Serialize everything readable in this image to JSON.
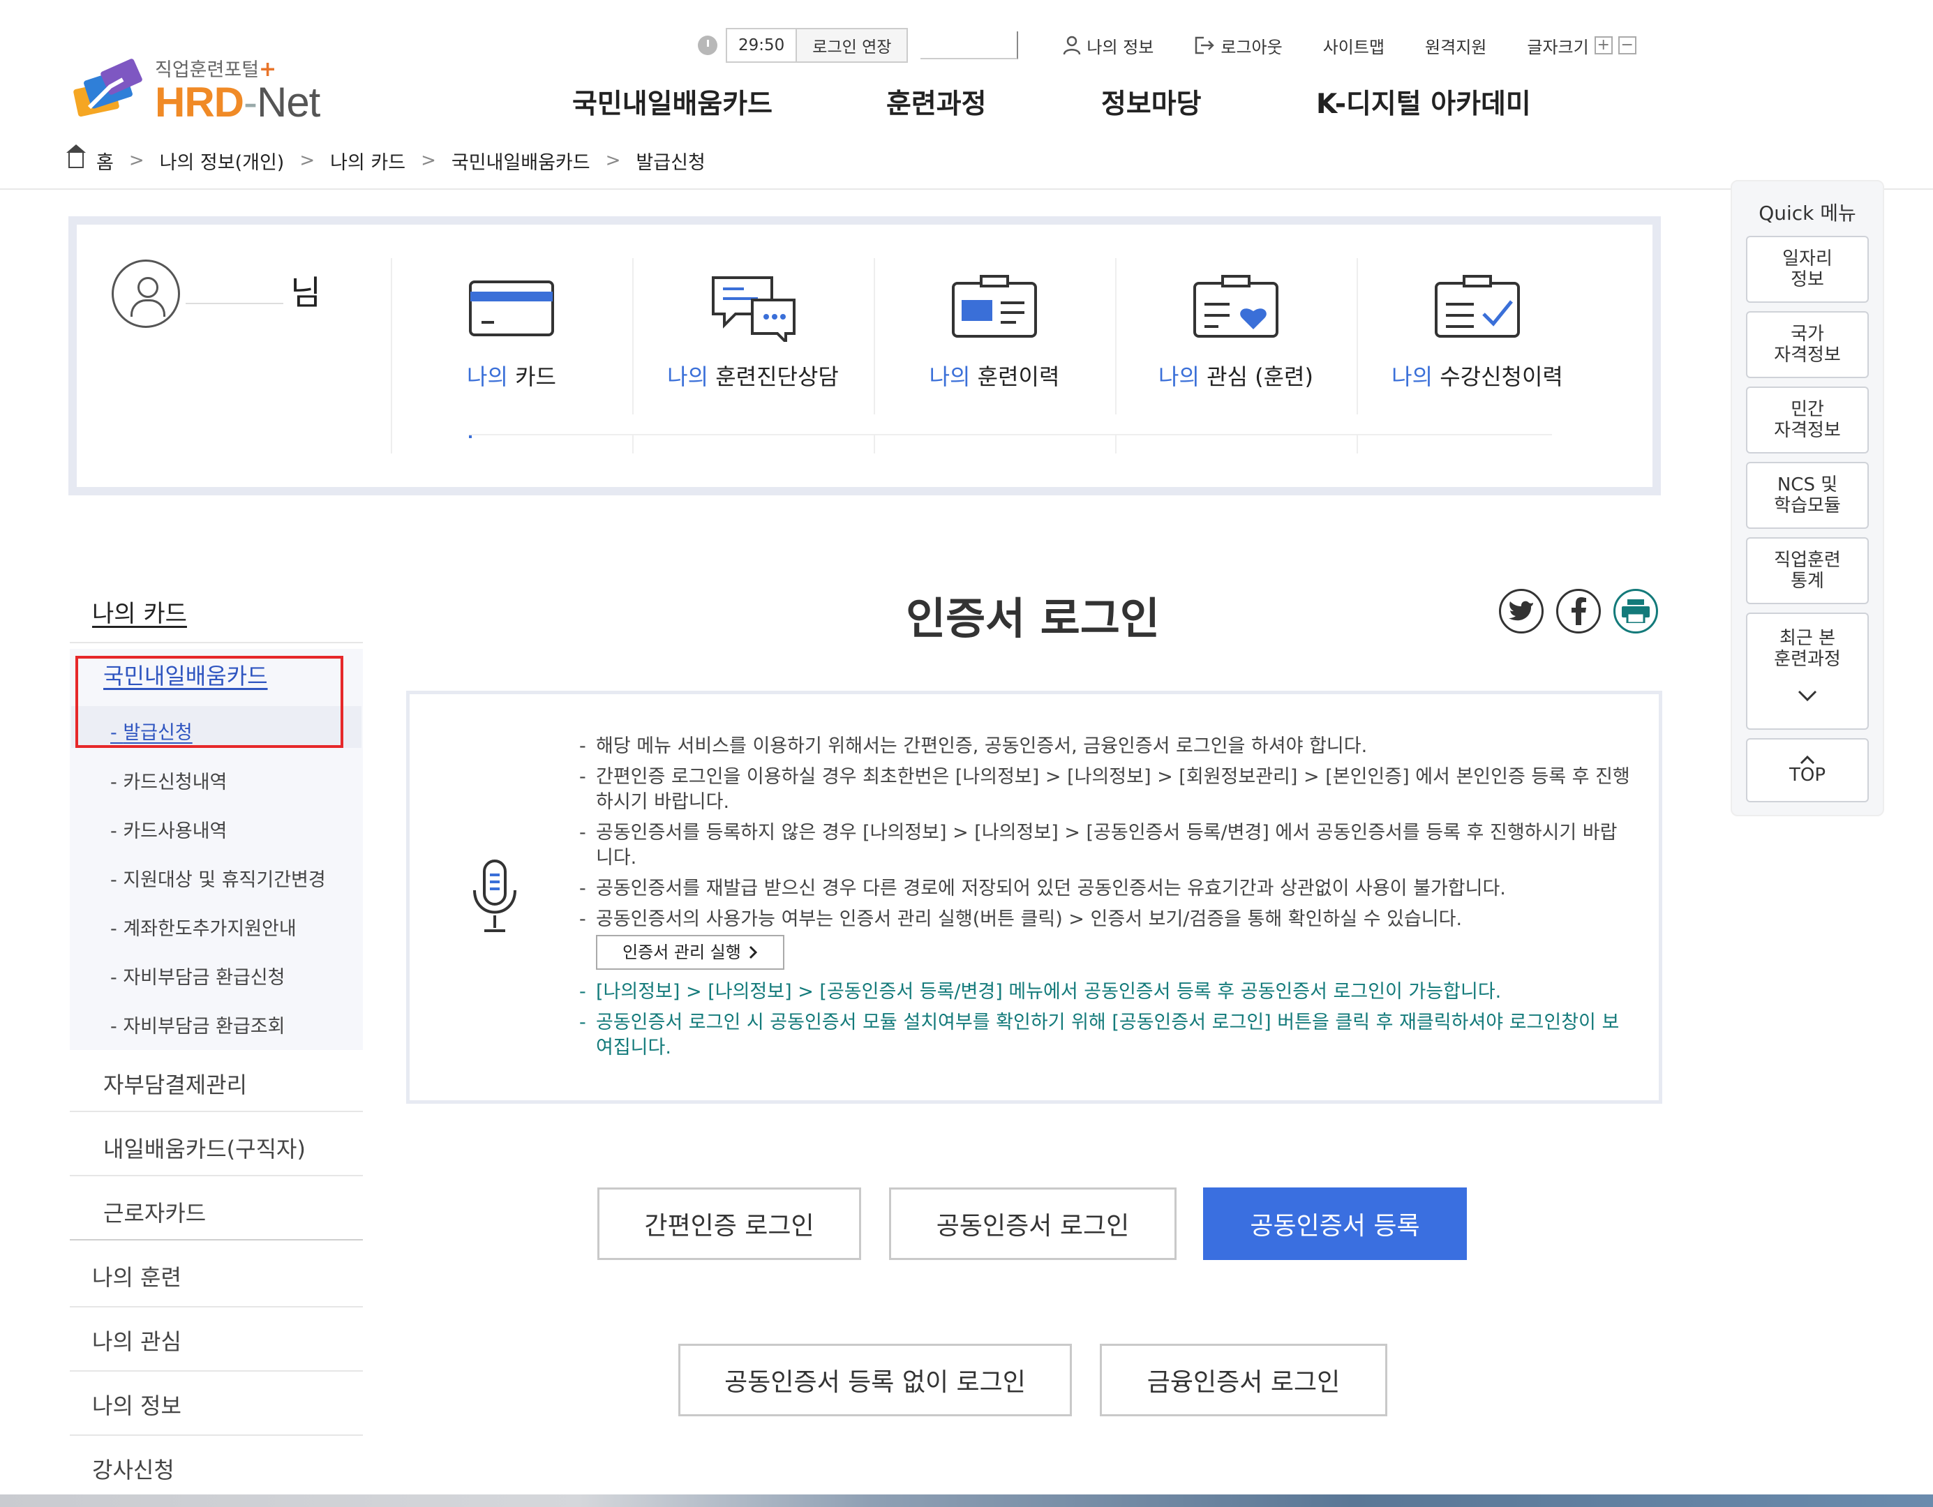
{
  "header": {
    "logo_sub": "직업훈련포털",
    "logo_main": "HRD",
    "logo_net": "Net",
    "timer": "29:50",
    "extend_label": "로그인 연장",
    "my_info": "나의 정보",
    "logout": "로그아웃",
    "sitemap": "사이트맵",
    "remote": "원격지원",
    "font_size": "글자크기",
    "plus": "+",
    "minus": "−"
  },
  "gnb": [
    "국민내일배움카드",
    "훈련과정",
    "정보마당",
    "K-디지털 아카데미"
  ],
  "breadcrumb": [
    "홈",
    "나의 정보(개인)",
    "나의 카드",
    "국민내일배움카드",
    "발급신청"
  ],
  "dashboard": {
    "name_suffix": "님",
    "items": [
      {
        "mine": "나의",
        "label": "카드",
        "icon": "card-icon"
      },
      {
        "mine": "나의",
        "label": "훈련진단상담",
        "icon": "chat-icon"
      },
      {
        "mine": "나의",
        "label": "훈련이력",
        "icon": "id-card-icon"
      },
      {
        "mine": "나의",
        "label": "관심 (훈련)",
        "icon": "heart-briefcase-icon"
      },
      {
        "mine": "나의",
        "label": "수강신청이력",
        "icon": "checklist-icon"
      }
    ]
  },
  "lnb": {
    "title": "나의 카드",
    "active": "국민내일배움카드",
    "subs": [
      "발급신청",
      "카드신청내역",
      "카드사용내역",
      "지원대상 및 휴직기간변경",
      "계좌한도추가지원안내",
      "자비부담금 환급신청",
      "자비부담금 환급조회"
    ],
    "cats_inner": [
      "자부담결제관리",
      "내일배움카드(구직자)",
      "근로자카드"
    ],
    "cats_outer": [
      "나의 훈련",
      "나의 관심",
      "나의 정보",
      "강사신청"
    ]
  },
  "main": {
    "title": "인증서 로그인",
    "info": [
      "해당 메뉴 서비스를 이용하기 위해서는 간편인증, 공동인증서, 금융인증서 로그인을 하셔야 합니다.",
      "간편인증 로그인을 이용하실 경우 최초한번은 [나의정보] > [나의정보] > [회원정보관리] > [본인인증] 에서 본인인증 등록 후 진행하시기 바랍니다.",
      "공동인증서를 등록하지 않은 경우 [나의정보] > [나의정보] > [공동인증서 등록/변경] 에서 공동인증서를 등록 후 진행하시기 바랍니다.",
      "공동인증서를 재발급 받으신 경우 다른 경로에 저장되어 있던 공동인증서는 유효기간과 상관없이 사용이 불가합니다.",
      "공동인증서의 사용가능 여부는 인증서 관리 실행(버튼 클릭) > 인증서 보기/검증을 통해 확인하실 수 있습니다."
    ],
    "cert_mgr_btn": "인증서 관리 실행",
    "teal_info": [
      "[나의정보] > [나의정보] > [공동인증서 등록/변경] 메뉴에서 공동인증서 등록 후 공동인증서 로그인이 가능합니다.",
      "공동인증서 로그인 시 공동인증서 모듈 설치여부를 확인하기 위해 [공동인증서 로그인] 버튼을 클릭 후 재클릭하셔야 로그인창이 보여집니다."
    ],
    "buttons": {
      "simple": "간편인증 로그인",
      "joint": "공동인증서 로그인",
      "register": "공동인증서 등록",
      "no_register": "공동인증서 등록 없이 로그인",
      "financial": "금융인증서 로그인"
    }
  },
  "quick": {
    "title": "Quick 메뉴",
    "items": [
      [
        "일자리",
        "정보"
      ],
      [
        "국가",
        "자격정보"
      ],
      [
        "민간",
        "자격정보"
      ],
      [
        "NCS 및",
        "학습모듈"
      ],
      [
        "직업훈련",
        "통계"
      ],
      [
        "최근 본",
        "훈련과정"
      ]
    ],
    "top": "TOP"
  },
  "colors": {
    "accent": "#3a6fe0",
    "highlight": "#e6282a",
    "teal": "#137a7a",
    "logo_orange": "#f08a26"
  }
}
